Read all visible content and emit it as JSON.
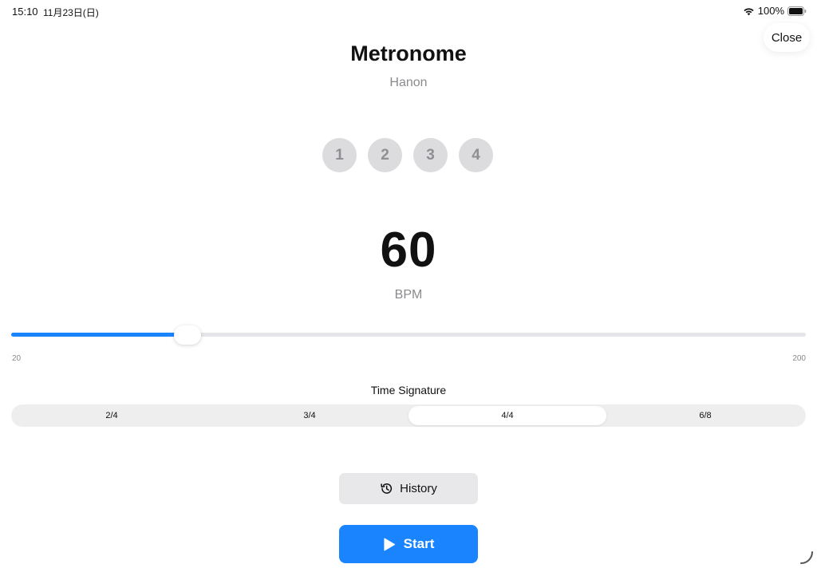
{
  "status_bar": {
    "time": "15:10",
    "date": "11月23日(日)",
    "battery_text": "100%",
    "icons": [
      "wifi-icon",
      "battery-icon"
    ]
  },
  "close_label": "Close",
  "title": "Metronome",
  "subtitle": "Hanon",
  "beats": [
    "1",
    "2",
    "3",
    "4"
  ],
  "bpm": {
    "value": "60",
    "label": "BPM"
  },
  "slider": {
    "min_label": "20",
    "max_label": "200",
    "min": 20,
    "max": 200,
    "value": 60
  },
  "time_signature": {
    "label": "Time Signature",
    "options": [
      "2/4",
      "3/4",
      "4/4",
      "6/8"
    ],
    "selected": "4/4"
  },
  "history_label": "History",
  "start_label": "Start",
  "colors": {
    "accent": "#1a84ff",
    "beat_inactive": "#dcdcde",
    "secondary_text": "#8a8a8e"
  }
}
